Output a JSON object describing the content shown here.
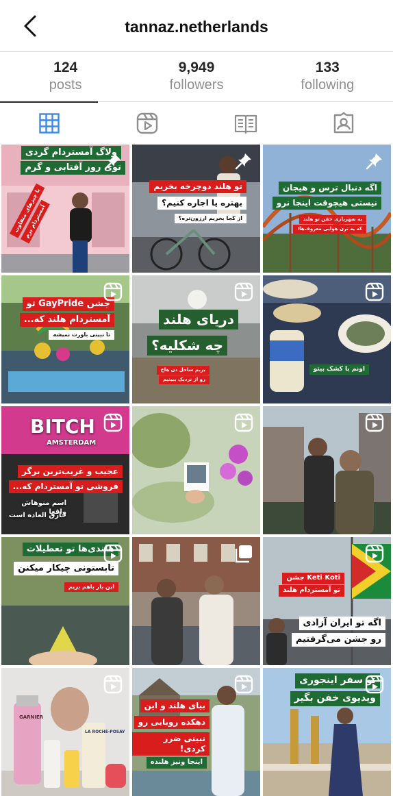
{
  "header": {
    "username": "tannaz.netherlands"
  },
  "stats": [
    {
      "value": "124",
      "label": "posts"
    },
    {
      "value": "9,949",
      "label": "followers"
    },
    {
      "value": "133",
      "label": "following"
    }
  ],
  "tabs": [
    {
      "icon": "grid-icon",
      "active": true
    },
    {
      "icon": "reels-icon",
      "active": false
    },
    {
      "icon": "guides-icon",
      "active": false
    },
    {
      "icon": "tagged-icon",
      "active": false
    }
  ],
  "posts": [
    {
      "badge": "pin-icon",
      "lines": [
        "ولاگ آمستردام گردی",
        "توی روز آفتابی و گرم",
        "با چیزهای متفاوت",
        "آمستردام برم"
      ]
    },
    {
      "badge": "pin-icon",
      "lines": [
        "تو هلند دوچرخه بخریم",
        "بهتره یا اجاره کنیم؟",
        "از کجا بخریم ارزون‌تره؟"
      ]
    },
    {
      "badge": "pin-icon",
      "lines": [
        "اگه دنبال ترس و هیجان",
        "نیستی هیچوقت اینجا نرو",
        "یه شهربازی خفن تو هلند",
        "که یه ترن هوایی معروف‌ها!"
      ]
    },
    {
      "badge": "reels-icon",
      "lines": [
        "جشن GayPride تو",
        "آمستردام هلند که...",
        "تا نبینی باورت نمیشه"
      ]
    },
    {
      "badge": "reels-icon",
      "lines": [
        "دریای هلند",
        "چه شکلیه؟",
        "بریم ساحل دن هاخ",
        "رو از نزدیک ببینیم"
      ]
    },
    {
      "badge": "reels-icon",
      "lines": [
        "اونم با کشک بیتو"
      ]
    },
    {
      "badge": "reels-icon",
      "lines": [
        "BITCH",
        "AMSTERDAM",
        "عجیب و غریب‌ترین برگر",
        "فروشی تو آمستردام که...",
        "اسم منوهاش واقعا",
        "خارق العاده است"
      ]
    },
    {
      "badge": "reels-icon",
      "lines": []
    },
    {
      "badge": "reels-icon",
      "lines": []
    },
    {
      "badge": "reels-icon",
      "lines": [
        "هلندی‌ها تو تعطیلات",
        "تابستونی چیکار میکنن",
        "این بار باهم بریم"
      ]
    },
    {
      "badge": "multi-icon",
      "lines": []
    },
    {
      "badge": "reels-icon",
      "lines": [
        "Keti Koti جشن",
        "تو آمستردام هلند",
        "اگه تو ایران آزادی",
        "رو جشن می‌گرفتیم"
      ]
    },
    {
      "badge": "reels-icon",
      "lines": [
        "GARNIER",
        "LA ROCHE-POSAY"
      ]
    },
    {
      "badge": "reels-icon",
      "lines": [
        "بیای هلند و این",
        "دهکده روبایی رو",
        "نبینی ضرر کردی!",
        "اینجا ونیز هلنده"
      ]
    },
    {
      "badge": "reels-icon",
      "lines": [
        "تو سفر اینجوری",
        "ویدیوی خفن بگیر"
      ]
    }
  ],
  "colors": {
    "accent_grid": "#3b8ae6",
    "caption_green": "#1e6b34",
    "caption_red": "#d91c1c"
  }
}
